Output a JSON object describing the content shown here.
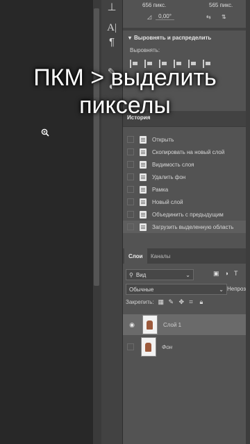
{
  "properties": {
    "width_value": "656 пикс.",
    "height_value": "565 пикс.",
    "angle_value": "0,00°",
    "align_section_title": "Выровнять и распределить",
    "align_sub_label": "Выровнять:"
  },
  "history": {
    "tab_label": "История",
    "items": [
      {
        "label": "Открыть"
      },
      {
        "label": "Скопировать на новый слой"
      },
      {
        "label": "Видимость слоя"
      },
      {
        "label": "Удалить фон"
      },
      {
        "label": "Рамка"
      },
      {
        "label": "Новый слой"
      },
      {
        "label": "Объединить с предыдущим"
      },
      {
        "label": "Загрузить выделенную область"
      }
    ]
  },
  "layers_panel": {
    "tab_layers": "Слои",
    "tab_channels": "Каналы",
    "kind_filter": "Вид",
    "blend_mode": "Обычные",
    "opacity_label": "Непрозр",
    "lock_label": "Закрепить:",
    "layers": [
      {
        "name": "Слой 1",
        "visible": true,
        "selected": true
      },
      {
        "name": "Фон",
        "visible": false,
        "selected": false
      }
    ]
  },
  "overlay": {
    "line1": "ПКМ > выделить",
    "line2": "пикселы"
  },
  "colors": {
    "panel_bg": "#535353",
    "dark_bg": "#282828",
    "toolbar_bg": "#424242",
    "selection": "#6a6a6a"
  }
}
